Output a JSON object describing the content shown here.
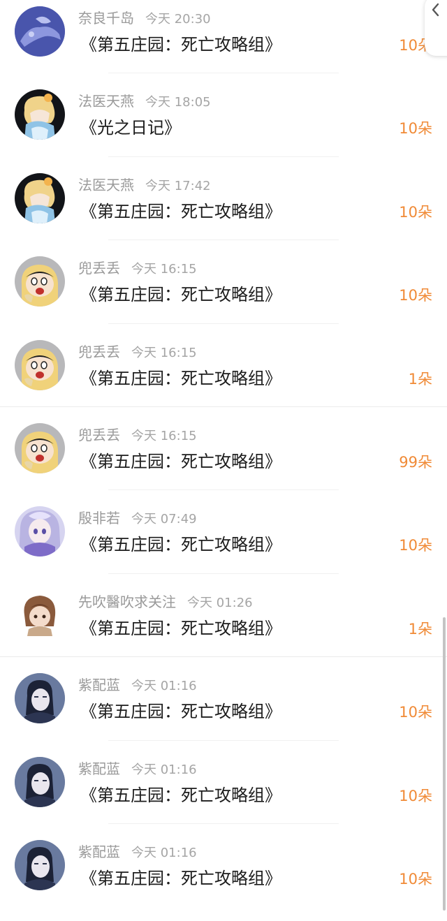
{
  "header": {
    "back_icon": "chevron-left-icon"
  },
  "colors": {
    "amount": "#f08a36",
    "username": "#9a9a9a",
    "title": "#1c1c1c"
  },
  "items": [
    {
      "user": "奈良千岛",
      "time": "今天 20:30",
      "title": "《第五庄园：死亡攻略组》",
      "amount": "10朵",
      "avatar": "avatar-nara"
    },
    {
      "user": "法医天燕",
      "time": "今天 18:05",
      "title": "《光之日记》",
      "amount": "10朵",
      "avatar": "avatar-fayi"
    },
    {
      "user": "法医天燕",
      "time": "今天 17:42",
      "title": "《第五庄园：死亡攻略组》",
      "amount": "10朵",
      "avatar": "avatar-fayi"
    },
    {
      "user": "兜丢丢",
      "time": "今天 16:15",
      "title": "《第五庄园：死亡攻略组》",
      "amount": "10朵",
      "avatar": "avatar-doudiu"
    },
    {
      "user": "兜丢丢",
      "time": "今天 16:15",
      "title": "《第五庄园：死亡攻略组》",
      "amount": "1朵",
      "avatar": "avatar-doudiu"
    },
    {
      "user": "兜丢丢",
      "time": "今天 16:15",
      "title": "《第五庄园：死亡攻略组》",
      "amount": "99朵",
      "avatar": "avatar-doudiu"
    },
    {
      "user": "殷非若",
      "time": "今天 07:49",
      "title": "《第五庄园：死亡攻略组》",
      "amount": "10朵",
      "avatar": "avatar-yin"
    },
    {
      "user": "先吹醫吹求关注",
      "time": "今天 01:26",
      "title": "《第五庄园：死亡攻略组》",
      "amount": "1朵",
      "avatar": "avatar-xian"
    },
    {
      "user": "紫配蓝",
      "time": "今天 01:16",
      "title": "《第五庄园：死亡攻略组》",
      "amount": "10朵",
      "avatar": "avatar-zi"
    },
    {
      "user": "紫配蓝",
      "time": "今天 01:16",
      "title": "《第五庄园：死亡攻略组》",
      "amount": "10朵",
      "avatar": "avatar-zi"
    },
    {
      "user": "紫配蓝",
      "time": "今天 01:16",
      "title": "《第五庄园：死亡攻略组》",
      "amount": "10朵",
      "avatar": "avatar-zi"
    }
  ]
}
